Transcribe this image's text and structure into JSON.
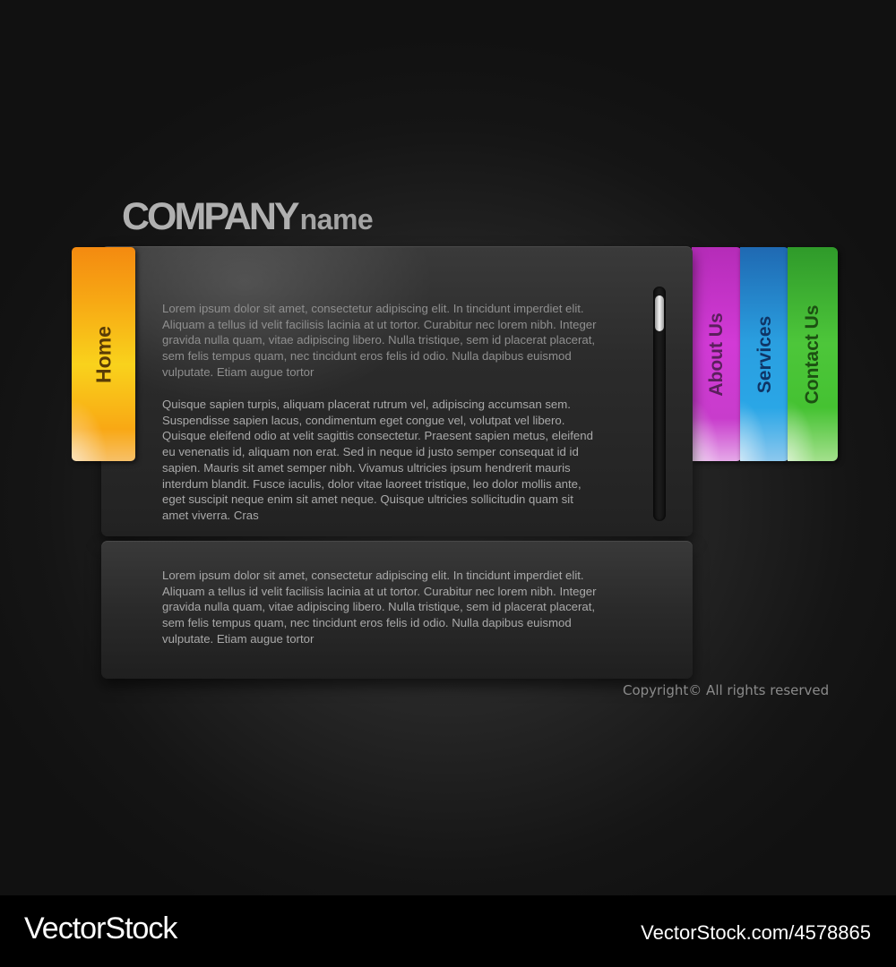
{
  "logo": {
    "primary": "COMPANY",
    "secondary": "name"
  },
  "nav": {
    "home": "Home",
    "about": "About Us",
    "services": "Services",
    "contact": "Contact Us"
  },
  "colors": {
    "home": "#f7a814",
    "about": "#d23ad6",
    "services": "#2a9fe0",
    "contact": "#4dc63a"
  },
  "content": {
    "top_panel": {
      "paragraph1": "Lorem ipsum dolor sit amet, consectetur adipiscing elit. In tincidunt imperdiet elit. Aliquam a tellus id velit facilisis lacinia at ut tortor. Curabitur nec lorem nibh. Integer gravida nulla quam, vitae adipiscing libero. Nulla tristique, sem id placerat placerat, sem felis tempus quam, nec tincidunt eros felis id odio. Nulla dapibus euismod vulputate. Etiam augue tortor",
      "paragraph2": "Quisque sapien turpis, aliquam placerat rutrum vel, adipiscing accumsan sem. Suspendisse sapien lacus, condimentum eget congue vel, volutpat vel libero. Quisque eleifend odio at velit sagittis consectetur. Praesent sapien metus, eleifend eu venenatis id, aliquam non erat. Sed in neque id justo semper consequat id id sapien. Mauris sit amet semper nibh. Vivamus ultricies ipsum hendrerit mauris interdum blandit. Fusce iaculis, dolor vitae laoreet tristique, leo dolor mollis ante, eget suscipit neque enim sit amet neque. Quisque ultricies sollicitudin quam sit amet viverra. Cras"
    },
    "bottom_panel": {
      "paragraph1": "Lorem ipsum dolor sit amet, consectetur adipiscing elit. In tincidunt imperdiet elit. Aliquam a tellus id velit facilisis lacinia at ut tortor. Curabitur nec lorem nibh. Integer gravida nulla quam, vitae adipiscing libero. Nulla tristique, sem id placerat placerat, sem felis tempus quam, nec tincidunt eros felis id odio. Nulla dapibus euismod vulputate. Etiam augue tortor"
    }
  },
  "copyright": "Copyright© All rights reserved",
  "watermark": {
    "brand": "VectorStock",
    "id_text": "VectorStock.com/4578865"
  }
}
